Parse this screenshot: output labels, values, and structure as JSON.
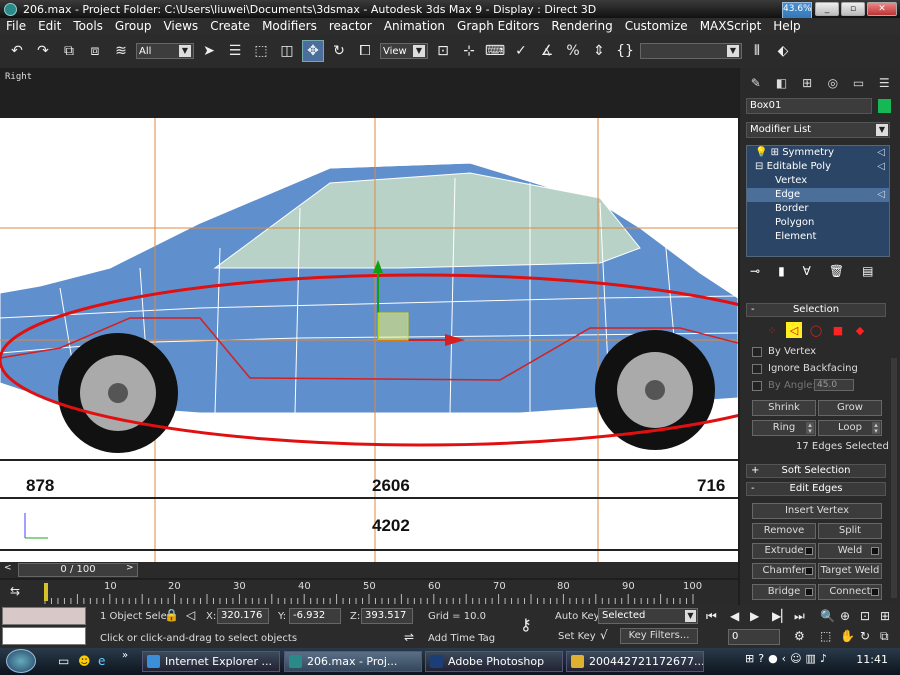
{
  "titlebar": {
    "title": "206.max    - Project Folder: C:\\Users\\liuwei\\Documents\\3dsmax        - Autodesk 3ds Max 9        - Display : Direct 3D",
    "cpu": "43.6%"
  },
  "menu": [
    "File",
    "Edit",
    "Tools",
    "Group",
    "Views",
    "Create",
    "Modifiers",
    "reactor",
    "Animation",
    "Graph Editors",
    "Rendering",
    "Customize",
    "MAXScript",
    "Help"
  ],
  "toolbar": {
    "selection_filter": "All",
    "ref_coord": "View"
  },
  "viewport": {
    "label": "Right",
    "dimensions": [
      "878",
      "2606",
      "716",
      "4202"
    ]
  },
  "command_panel": {
    "object_name": "Box01",
    "modifier_list": "Modifier List",
    "stack": [
      {
        "label": "Symmetry",
        "level": 0,
        "selected": false
      },
      {
        "label": "Editable Poly",
        "level": 0,
        "selected": false
      },
      {
        "label": "Vertex",
        "level": 1,
        "selected": false
      },
      {
        "label": "Edge",
        "level": 1,
        "selected": true
      },
      {
        "label": "Border",
        "level": 1,
        "selected": false
      },
      {
        "label": "Polygon",
        "level": 1,
        "selected": false
      },
      {
        "label": "Element",
        "level": 1,
        "selected": false
      }
    ],
    "rollout_selection": "Selection",
    "by_vertex": "By Vertex",
    "ignore_backfacing": "Ignore Backfacing",
    "by_angle": "By Angle:",
    "angle_value": "45.0",
    "shrink": "Shrink",
    "grow": "Grow",
    "ring": "Ring",
    "loop": "Loop",
    "edges_selected": "17 Edges Selected",
    "rollout_soft": "Soft Selection",
    "rollout_edit_edges": "Edit Edges",
    "insert_vertex": "Insert Vertex",
    "remove": "Remove",
    "split": "Split",
    "extrude": "Extrude",
    "weld": "Weld",
    "chamfer": "Chamfer",
    "target_weld": "Target Weld",
    "bridge": "Bridge",
    "connect": "Connect"
  },
  "timeline": {
    "frame": "0 / 100",
    "ticks": [
      "10",
      "20",
      "30",
      "40",
      "50",
      "60",
      "70",
      "80",
      "90",
      "100"
    ]
  },
  "status": {
    "objects": "1 Object Sele",
    "x_label": "X:",
    "x_value": "320.176",
    "y_label": "Y:",
    "y_value": "-6.932",
    "z_label": "Z:",
    "z_value": "393.517",
    "grid": "Grid = 10.0",
    "auto_key": "Auto Key",
    "selected": "Selected",
    "set_key": "Set Key",
    "key_filters": "Key Filters...",
    "prompt": "Click or click-and-drag to select objects",
    "add_time_tag": "Add Time Tag",
    "frame_field": "0"
  },
  "taskbar": {
    "tasks": [
      "Internet Explorer ...",
      "206.max      - Proj...",
      "Adobe Photoshop",
      "200442721172677..."
    ],
    "clock": "11:41"
  }
}
